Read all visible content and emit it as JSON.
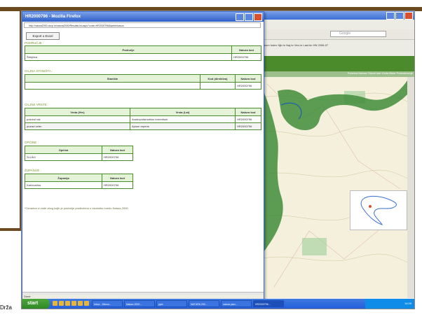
{
  "slide": {
    "side_text": "Drža"
  },
  "popup": {
    "title": "HR2000796 - Mozilla Firefox",
    "url": "http://natura2000.dzzp.hr/natura2000/ResultsList.aspx?code=HR2000796&webkrivaccs",
    "export_button": "Export u Excel",
    "status": "Done",
    "sections": {
      "podrucje": {
        "label": "PODRUČJE :",
        "headers": [
          "Područje",
          "Natura kod"
        ],
        "rows": [
          [
            "Štmjčica",
            "HR2000796"
          ]
        ]
      },
      "stanista": {
        "label": "CILJNA STANIŠTA :",
        "headers": [
          "Stanište",
          "Kod (direktiva)",
          "Natura kod"
        ],
        "rows": [
          [
            "",
            "",
            "HR2000796"
          ]
        ]
      },
      "vrste": {
        "label": "CILJNE VRSTE :",
        "headers": [
          "Vrsta (Hrv)",
          "Vrsta (Lat)",
          "Natura kod"
        ],
        "rows": [
          [
            "potočni rak",
            "Austropotamobius torrentium",
            "HR2000796"
          ],
          [
            "puzavi celer",
            "Apium repens",
            "HR2000796"
          ]
        ]
      },
      "opcine": {
        "label": "OPĆINE :",
        "headers": [
          "Općina",
          "Natura kod"
        ],
        "rows": [
          [
            "SLUNJ",
            "HR2000796"
          ]
        ]
      },
      "zupanije": {
        "label": "ŽUPANIJE :",
        "headers": [
          "Županija",
          "Natura kod"
        ],
        "rows": [
          [
            "Karlovačka",
            "HR2000796"
          ]
        ]
      }
    },
    "footnote": "*Označna iz vrste zbog kojih je područje predloženo u ekološku mrežu Natura 2000"
  },
  "background_browser": {
    "search_placeholder": "Google",
    "bookmarks": "Forum  Index  Njk.hr  Naj.hr  Ves.hr  Last.fm  HN  2008-07",
    "menu": "Početna  Natura  Glavni kart  Karta Biote  Pretraživanje"
  },
  "taskbar": {
    "start_label": "start",
    "tasks": [
      {
        "label": "Inbox - Micros...",
        "active": false
      },
      {
        "label": "Natura 2000 ...",
        "active": false
      },
      {
        "label": "pptx",
        "active": false
      },
      {
        "label": "NATURA 200...",
        "active": false
      },
      {
        "label": "natura plan...",
        "active": false
      },
      {
        "label": "HR2000796...",
        "active": true
      }
    ],
    "clock": "14:09"
  },
  "colors": {
    "accent_green": "#4b8b2c",
    "header_green": "#e4f2d8",
    "slide_brown": "#6b4a1f",
    "xp_blue": "#245edc"
  }
}
